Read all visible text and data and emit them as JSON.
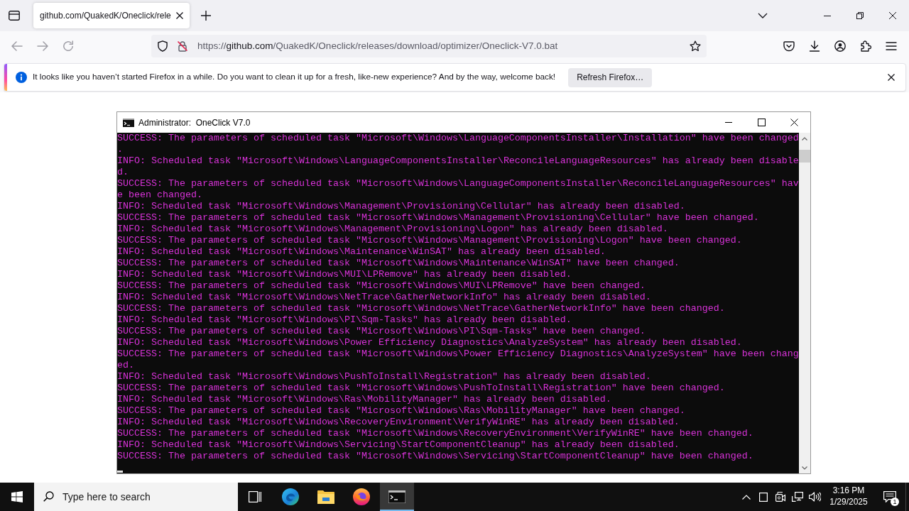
{
  "browser": {
    "tabs": [
      {
        "title": "github.com/QuakedK/Oneclick/rele",
        "selected": true
      }
    ],
    "nav_buttons": [
      {
        "kind": "back",
        "disabled": true
      },
      {
        "kind": "forward",
        "disabled": true
      },
      {
        "kind": "reload",
        "disabled": true
      }
    ],
    "url": "https://**github.com**/QuakedK/Oneclick/releases/download/optimizer/Oneclick-V7.0.bat",
    "notification": {
      "message": "It looks like you haven’t started Firefox in a while. Do you want to clean it up for a fresh, like-new experience? And by the way, welcome back!",
      "button": "Refresh Firefox…"
    }
  },
  "console": {
    "title": "Administrator:  OneClick V7.0",
    "lines": [
      "SUCCESS: The parameters of scheduled task \"Microsoft\\Windows\\LanguageComponentsInstaller\\Installation\" have been changed",
      ".",
      "INFO: Scheduled task \"Microsoft\\Windows\\LanguageComponentsInstaller\\ReconcileLanguageResources\" has already been disable",
      "d.",
      "SUCCESS: The parameters of scheduled task \"Microsoft\\Windows\\LanguageComponentsInstaller\\ReconcileLanguageResources\" hav",
      "e been changed.",
      "INFO: Scheduled task \"Microsoft\\Windows\\Management\\Provisioning\\Cellular\" has already been disabled.",
      "SUCCESS: The parameters of scheduled task \"Microsoft\\Windows\\Management\\Provisioning\\Cellular\" have been changed.",
      "INFO: Scheduled task \"Microsoft\\Windows\\Management\\Provisioning\\Logon\" has already been disabled.",
      "SUCCESS: The parameters of scheduled task \"Microsoft\\Windows\\Management\\Provisioning\\Logon\" have been changed.",
      "INFO: Scheduled task \"Microsoft\\Windows\\Maintenance\\WinSAT\" has already been disabled.",
      "SUCCESS: The parameters of scheduled task \"Microsoft\\Windows\\Maintenance\\WinSAT\" have been changed.",
      "INFO: Scheduled task \"Microsoft\\Windows\\MUI\\LPRemove\" has already been disabled.",
      "SUCCESS: The parameters of scheduled task \"Microsoft\\Windows\\MUI\\LPRemove\" have been changed.",
      "INFO: Scheduled task \"Microsoft\\Windows\\NetTrace\\GatherNetworkInfo\" has already been disabled.",
      "SUCCESS: The parameters of scheduled task \"Microsoft\\Windows\\NetTrace\\GatherNetworkInfo\" have been changed.",
      "INFO: Scheduled task \"Microsoft\\Windows\\PI\\Sqm-Tasks\" has already been disabled.",
      "SUCCESS: The parameters of scheduled task \"Microsoft\\Windows\\PI\\Sqm-Tasks\" have been changed.",
      "INFO: Scheduled task \"Microsoft\\Windows\\Power Efficiency Diagnostics\\AnalyzeSystem\" has already been disabled.",
      "SUCCESS: The parameters of scheduled task \"Microsoft\\Windows\\Power Efficiency Diagnostics\\AnalyzeSystem\" have been chang",
      "ed.",
      "INFO: Scheduled task \"Microsoft\\Windows\\PushToInstall\\Registration\" has already been disabled.",
      "SUCCESS: The parameters of scheduled task \"Microsoft\\Windows\\PushToInstall\\Registration\" have been changed.",
      "INFO: Scheduled task \"Microsoft\\Windows\\Ras\\MobilityManager\" has already been disabled.",
      "SUCCESS: The parameters of scheduled task \"Microsoft\\Windows\\Ras\\MobilityManager\" have been changed.",
      "INFO: Scheduled task \"Microsoft\\Windows\\RecoveryEnvironment\\VerifyWinRE\" has already been disabled.",
      "SUCCESS: The parameters of scheduled task \"Microsoft\\Windows\\RecoveryEnvironment\\VerifyWinRE\" have been changed.",
      "INFO: Scheduled task \"Microsoft\\Windows\\Servicing\\StartComponentCleanup\" has already been disabled.",
      "SUCCESS: The parameters of scheduled task \"Microsoft\\Windows\\Servicing\\StartComponentCleanup\" have been changed."
    ]
  },
  "taskbar": {
    "search": {
      "placeholder": "Type here to search"
    },
    "apps": [
      {
        "kind": "edge",
        "active": false
      },
      {
        "kind": "files",
        "active": false
      },
      {
        "kind": "firefox",
        "active": false
      },
      {
        "kind": "console",
        "active": true
      }
    ],
    "clock": {
      "time": "3:16 PM",
      "date": "1/29/2025"
    },
    "notification_count": "1"
  }
}
